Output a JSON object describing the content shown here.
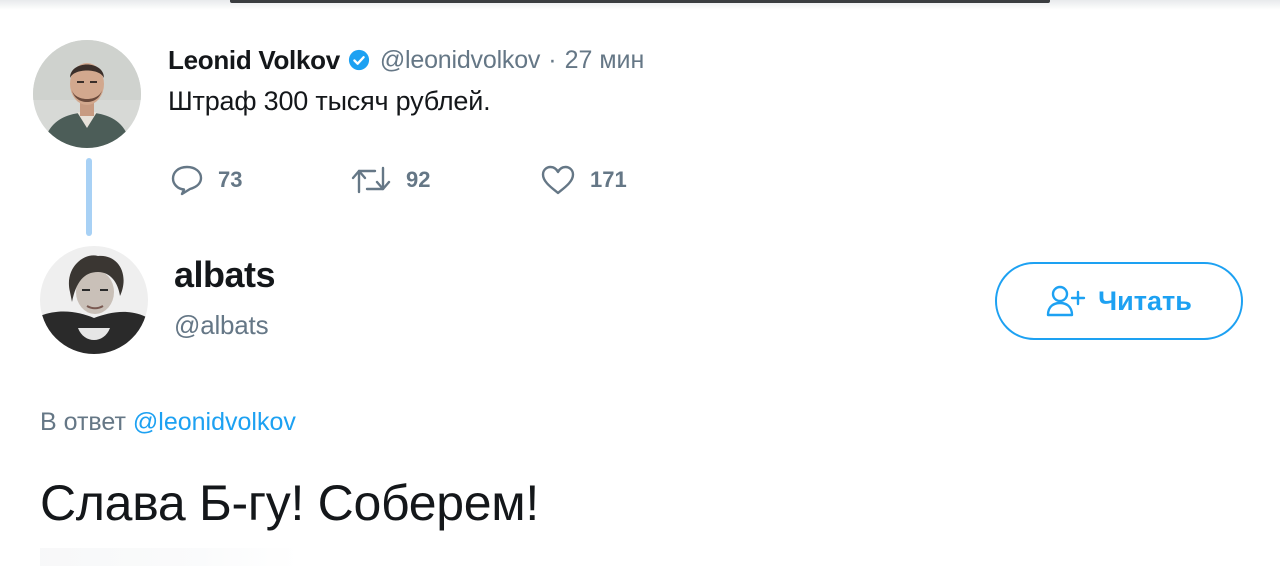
{
  "tweet": {
    "author_name": "Leonid Volkov",
    "author_handle": "@leonidvolkov",
    "separator": "·",
    "time": "27 мин",
    "text": "Штраф 300 тысяч рублей.",
    "reply_count": "73",
    "retweet_count": "92",
    "like_count": "171",
    "verified_color": "#1da1f2"
  },
  "reply": {
    "author_name": "albats",
    "author_handle": "@albats",
    "follow_label": "Читать",
    "reply_prefix": "В ответ",
    "reply_mention": "@leonidvolkov",
    "text": "Слава Б-гу! Соберем!"
  },
  "colors": {
    "accent": "#1da1f2",
    "secondary_text": "#657786",
    "primary_text": "#14171a",
    "thread_line": "#a8d1f5"
  },
  "icons": {
    "reply": "speech-bubble-icon",
    "retweet": "retweet-icon",
    "like": "heart-icon",
    "verified": "verified-badge-icon",
    "follow": "person-add-icon"
  }
}
